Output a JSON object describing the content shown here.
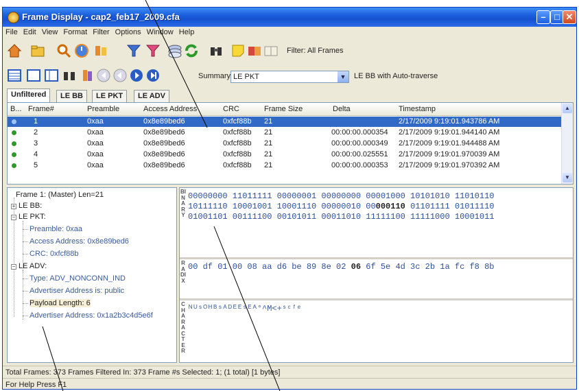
{
  "window": {
    "title": "Frame Display - cap2_feb17_2009.cfa"
  },
  "menu": [
    "File",
    "Edit",
    "View",
    "Format",
    "Filter",
    "Options",
    "Window",
    "Help"
  ],
  "toolbar": {
    "filter_label": "Filter:  All Frames",
    "summary_label": "Summary",
    "summary_value": "LE PKT",
    "autotraverse_label": "LE BB with Auto-traverse"
  },
  "tabs": [
    "Unfiltered",
    "LE BB",
    "LE PKT",
    "LE ADV"
  ],
  "grid": {
    "columns": [
      "B...",
      "Frame#",
      "Preamble",
      "Access Address",
      "CRC",
      "Frame Size",
      "Delta",
      "Timestamp"
    ],
    "rows": [
      [
        "1",
        "0xaa",
        "0x8e89bed6",
        "0xfcf88b",
        "21",
        "",
        "2/17/2009 9:19:01.943786 AM"
      ],
      [
        "2",
        "0xaa",
        "0x8e89bed6",
        "0xfcf88b",
        "21",
        "00:00:00.000354",
        "2/17/2009 9:19:01.944140 AM"
      ],
      [
        "3",
        "0xaa",
        "0x8e89bed6",
        "0xfcf88b",
        "21",
        "00:00:00.000349",
        "2/17/2009 9:19:01.944488 AM"
      ],
      [
        "4",
        "0xaa",
        "0x8e89bed6",
        "0xfcf88b",
        "21",
        "00:00:00.025551",
        "2/17/2009 9:19:01.970039 AM"
      ],
      [
        "5",
        "0xaa",
        "0x8e89bed6",
        "0xfcf88b",
        "21",
        "00:00:00.000353",
        "2/17/2009 9:19:01.970392 AM"
      ]
    ]
  },
  "tree": {
    "frame": "Frame 1: (Master) Len=21",
    "le_bb": "LE BB:",
    "le_pkt": "LE PKT:",
    "preamble": "Preamble: 0xaa",
    "access": "Access Address: 0x8e89bed6",
    "crc": "CRC: 0xfcf88b",
    "le_adv": "LE ADV:",
    "type": "Type: ADV_NONCONN_IND",
    "adv_addr_is": "Advertiser Address is: public",
    "payload": "Payload Length: 6",
    "adv_addr": "Advertiser Address: 0x1a2b3c4d5e6f"
  },
  "binary": {
    "label": "BINARY",
    "line1": "00000000 11011111 00000001 00000000 00001000 10101010 11010110",
    "line2a": "10111110 10001001 10001110 00000010 00",
    "line2b": "000110",
    "line2c": " 01101111 01011110",
    "line3": "01001101 00111100 00101011 00011010 11111100 11111000 10001011"
  },
  "hex": {
    "label": "RADIX",
    "line_a": "00 df 01 00 08 aa d6 be 89 8e 02 ",
    "line_b": "06",
    "line_c": " 6f 5e 4d 3c 2b 1a fc f8 8b"
  },
  "character": {
    "label": "CHARACTER",
    "line": "ᴺᵁˢᴼᴴᴮˢᴬᴰᴱᴱˢᴱᴬ°^M<+ˢᶜᶠᵉ"
  },
  "status": {
    "total": "Total Frames:  373  Frames Filtered In:  373  Frame #s Selected:  1; (1 total) [1 bytes]",
    "help": "For Help Press F1"
  }
}
